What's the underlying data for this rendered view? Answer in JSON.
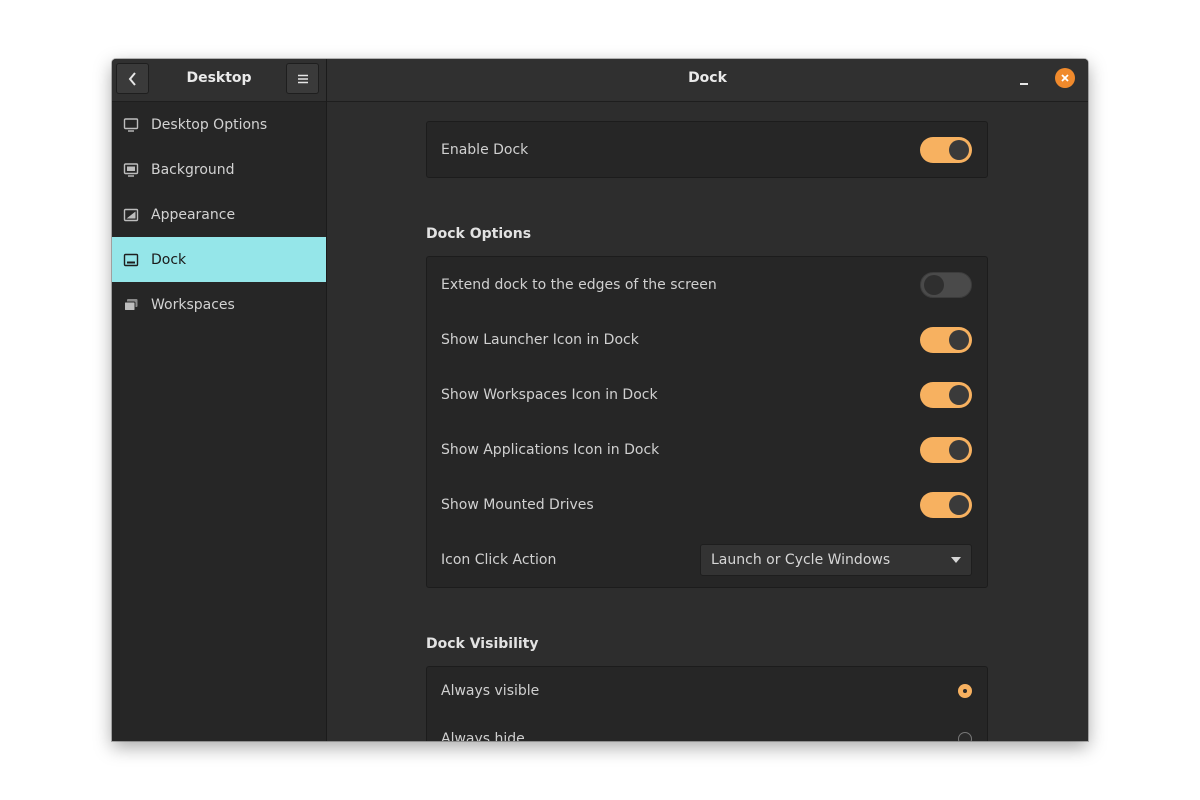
{
  "sidebar": {
    "title": "Desktop",
    "items": [
      {
        "label": "Desktop Options",
        "icon": "monitor-icon"
      },
      {
        "label": "Background",
        "icon": "image-icon"
      },
      {
        "label": "Appearance",
        "icon": "appearance-icon"
      },
      {
        "label": "Dock",
        "icon": "dock-icon",
        "active": true
      },
      {
        "label": "Workspaces",
        "icon": "workspaces-icon"
      }
    ]
  },
  "header": {
    "title": "Dock"
  },
  "enable_dock": {
    "label": "Enable Dock",
    "enabled": true
  },
  "dock_options": {
    "title": "Dock Options",
    "extend_edges": {
      "label": "Extend dock to the edges of the screen",
      "enabled": false
    },
    "launcher_icon": {
      "label": "Show Launcher Icon in Dock",
      "enabled": true
    },
    "workspaces_icon": {
      "label": "Show Workspaces Icon in Dock",
      "enabled": true
    },
    "applications_icon": {
      "label": "Show Applications Icon in Dock",
      "enabled": true
    },
    "mounted_drives": {
      "label": "Show Mounted Drives",
      "enabled": true
    },
    "click_action": {
      "label": "Icon Click Action",
      "value": "Launch or Cycle Windows"
    }
  },
  "dock_visibility": {
    "title": "Dock Visibility",
    "options": [
      {
        "label": "Always visible",
        "selected": true
      },
      {
        "label": "Always hide",
        "selected": false
      }
    ]
  },
  "colors": {
    "accent": "#f7b160",
    "close": "#f08a2c",
    "selected_item": "#95e6e9",
    "background": "#2d2d2d"
  }
}
